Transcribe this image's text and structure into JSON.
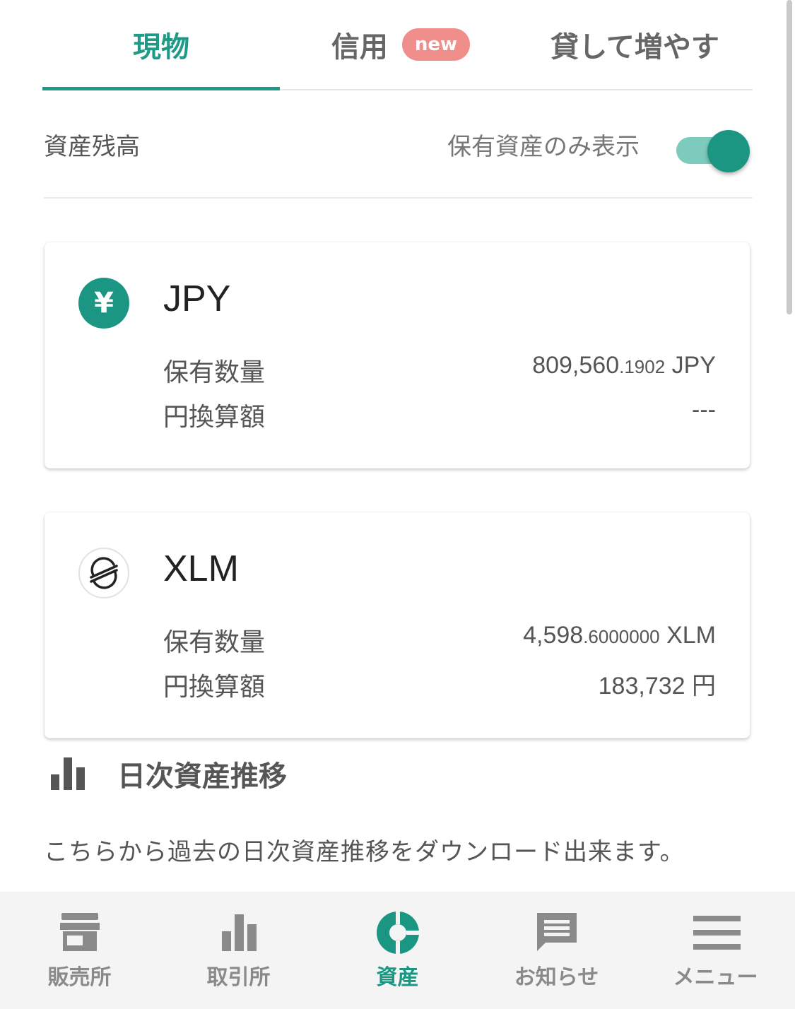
{
  "tabs": {
    "genbutsu": "現物",
    "shinyo": "信用",
    "shinyo_badge": "new",
    "kashite": "貸して増やす"
  },
  "balance": {
    "title": "資産残高",
    "toggle_label": "保有資産のみ表示",
    "toggle_on": true
  },
  "assets": [
    {
      "symbol": "JPY",
      "icon": "yen-icon",
      "icon_text": "¥",
      "quantity_label": "保有数量",
      "quantity_main": "809,560",
      "quantity_fraction": ".1902",
      "quantity_unit": " JPY",
      "jpy_label": "円換算額",
      "jpy_value": "---"
    },
    {
      "symbol": "XLM",
      "icon": "stellar-icon",
      "quantity_label": "保有数量",
      "quantity_main": "4,598",
      "quantity_fraction": ".6000000",
      "quantity_unit": " XLM",
      "jpy_label": "円換算額",
      "jpy_value": "183,732 円"
    }
  ],
  "daily": {
    "title": "日次資産推移",
    "description": "こちらから過去の日次資産推移をダウンロード出来ます。"
  },
  "nav": [
    {
      "label": "販売所",
      "icon": "store-icon"
    },
    {
      "label": "取引所",
      "icon": "bar-chart-icon"
    },
    {
      "label": "資産",
      "icon": "pie-chart-icon",
      "active": true
    },
    {
      "label": "お知らせ",
      "icon": "message-icon"
    },
    {
      "label": "メニュー",
      "icon": "menu-icon"
    }
  ],
  "colors": {
    "accent": "#1f9a86",
    "badge": "#ef8e8a",
    "toggle_track": "#7ccbbd",
    "inactive": "#8a8a8a"
  }
}
